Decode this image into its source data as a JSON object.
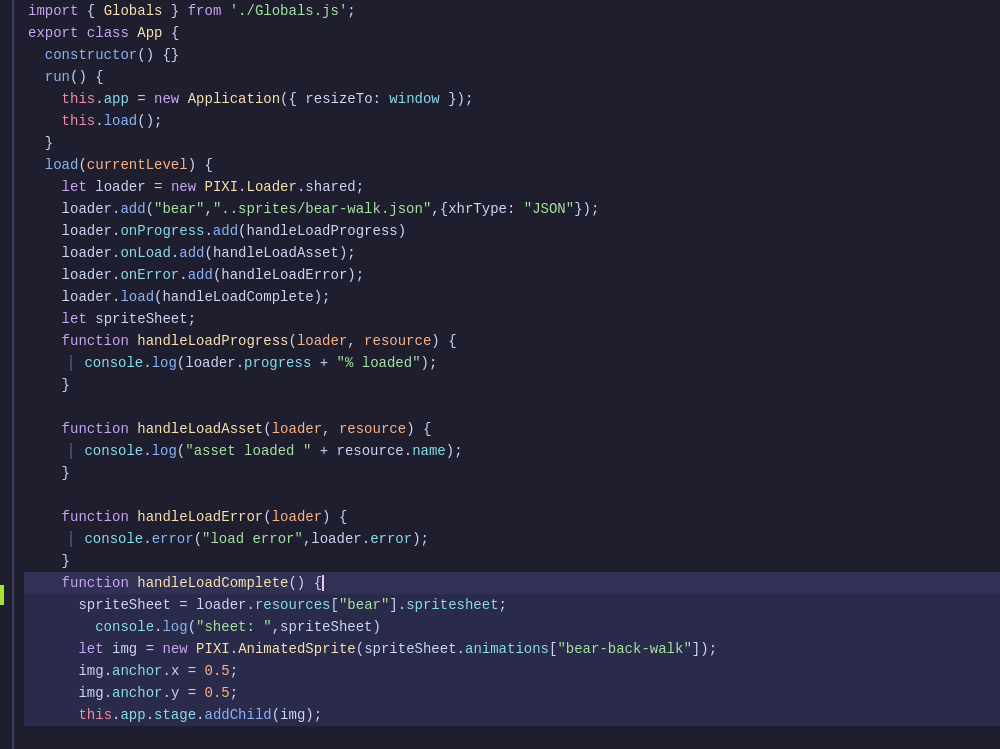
{
  "editor": {
    "background": "#1e1e2e",
    "lines": [
      {
        "indent": 0,
        "content": "import { Globals } from './Globals.js';"
      },
      {
        "indent": 0,
        "content": "export class App {"
      },
      {
        "indent": 1,
        "content": "  constructor() {}"
      },
      {
        "indent": 1,
        "content": "  run() {"
      },
      {
        "indent": 2,
        "content": "    this.app = new Application({ resizeTo: window });"
      },
      {
        "indent": 2,
        "content": "    this.load();"
      },
      {
        "indent": 1,
        "content": "  }"
      },
      {
        "indent": 1,
        "content": "  load(currentLevel) {"
      },
      {
        "indent": 2,
        "content": "    let loader = new PIXI.Loader.shared;"
      },
      {
        "indent": 2,
        "content": "    loader.add(\"bear\",\"..sprites/bear-walk.json\",{xhrType: \"JSON\"});"
      },
      {
        "indent": 2,
        "content": "    loader.onProgress.add(handleLoadProgress)"
      },
      {
        "indent": 2,
        "content": "    loader.onLoad.add(handleLoadAsset);"
      },
      {
        "indent": 2,
        "content": "    loader.onError.add(handleLoadError);"
      },
      {
        "indent": 2,
        "content": "    loader.load(handleLoadComplete);"
      },
      {
        "indent": 2,
        "content": "    let spriteSheet;"
      },
      {
        "indent": 2,
        "content": "    function handleLoadProgress(loader, resource) {"
      },
      {
        "indent": 3,
        "content": "      console.log(loader.progress + \"% loaded\");"
      },
      {
        "indent": 2,
        "content": "    }"
      },
      {
        "indent": 0,
        "content": ""
      },
      {
        "indent": 2,
        "content": "    function handleLoadAsset(loader, resource) {"
      },
      {
        "indent": 3,
        "content": "      console.log(\"asset loaded \" + resource.name);"
      },
      {
        "indent": 2,
        "content": "    }"
      },
      {
        "indent": 0,
        "content": ""
      },
      {
        "indent": 2,
        "content": "    function handleLoadError(loader) {"
      },
      {
        "indent": 3,
        "content": "      console.error(\"load error\",loader.error);"
      },
      {
        "indent": 2,
        "content": "    }"
      },
      {
        "indent": 2,
        "content": "    function handleLoadComplete() {"
      },
      {
        "indent": 3,
        "content": "      spriteSheet = loader.resources[\"bear\"].spritesheet;"
      },
      {
        "indent": 4,
        "content": "        console.log(\"sheet: \",spriteSheet)"
      },
      {
        "indent": 3,
        "content": "      let img = new PIXI.AnimatedSprite(spriteSheet.animations[\"bear-back-walk\"]);"
      },
      {
        "indent": 3,
        "content": "      img.anchor.x = 0.5;"
      },
      {
        "indent": 3,
        "content": "      img.anchor.y = 0.5;"
      },
      {
        "indent": 3,
        "content": "      this.app.stage.addChild(img);"
      }
    ]
  }
}
